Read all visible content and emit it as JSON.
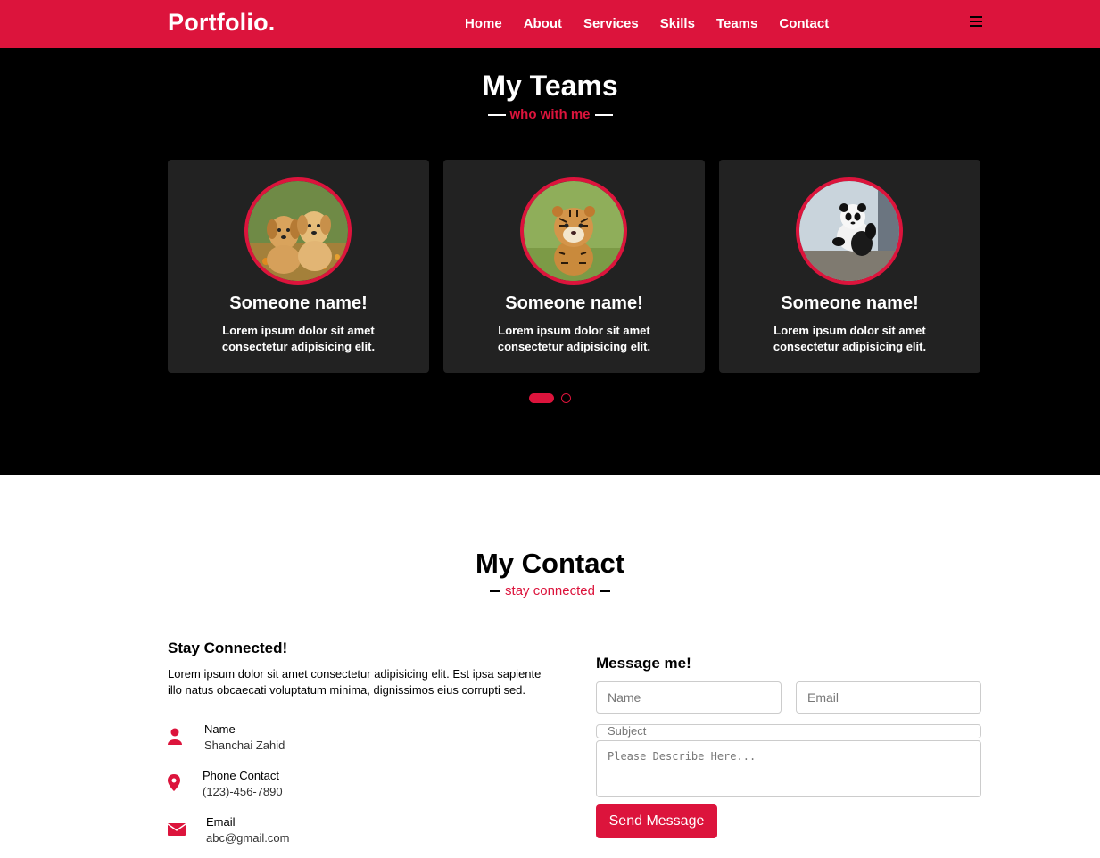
{
  "navbar": {
    "logo": "Portfolio.",
    "menu": [
      "Home",
      "About",
      "Services",
      "Skills",
      "Teams",
      "Contact"
    ],
    "brand_color": "#dc143c"
  },
  "teams": {
    "title": "My Teams",
    "subtitle": "who with me",
    "cards": [
      {
        "name": "Someone name!",
        "text": "Lorem ipsum dolor sit amet consectetur adipisicing elit.",
        "photo": "puppies"
      },
      {
        "name": "Someone name!",
        "text": "Lorem ipsum dolor sit amet consectetur adipisicing elit.",
        "photo": "tiger-cub"
      },
      {
        "name": "Someone name!",
        "text": "Lorem ipsum dolor sit amet consectetur adipisicing elit.",
        "photo": "panda"
      }
    ]
  },
  "contact": {
    "title": "My Contact",
    "subtitle": "stay connected",
    "left": {
      "title": "Stay Connected!",
      "text": "Lorem ipsum dolor sit amet consectetur adipisicing elit. Est ipsa sapiente illo natus obcaecati voluptatum minima, dignissimos eius corrupti sed.",
      "items": [
        {
          "label": "Name",
          "value": "Shanchai Zahid",
          "icon": "user-icon"
        },
        {
          "label": "Phone Contact",
          "value": "(123)-456-7890",
          "icon": "map-marker-icon"
        },
        {
          "label": "Email",
          "value": "abc@gmail.com",
          "icon": "envelope-icon"
        }
      ]
    },
    "form": {
      "title": "Message me!",
      "name_placeholder": "Name",
      "email_placeholder": "Email",
      "subject_placeholder": "Subject",
      "message_placeholder": "Please Describe Here...",
      "submit_label": "Send Message"
    }
  }
}
